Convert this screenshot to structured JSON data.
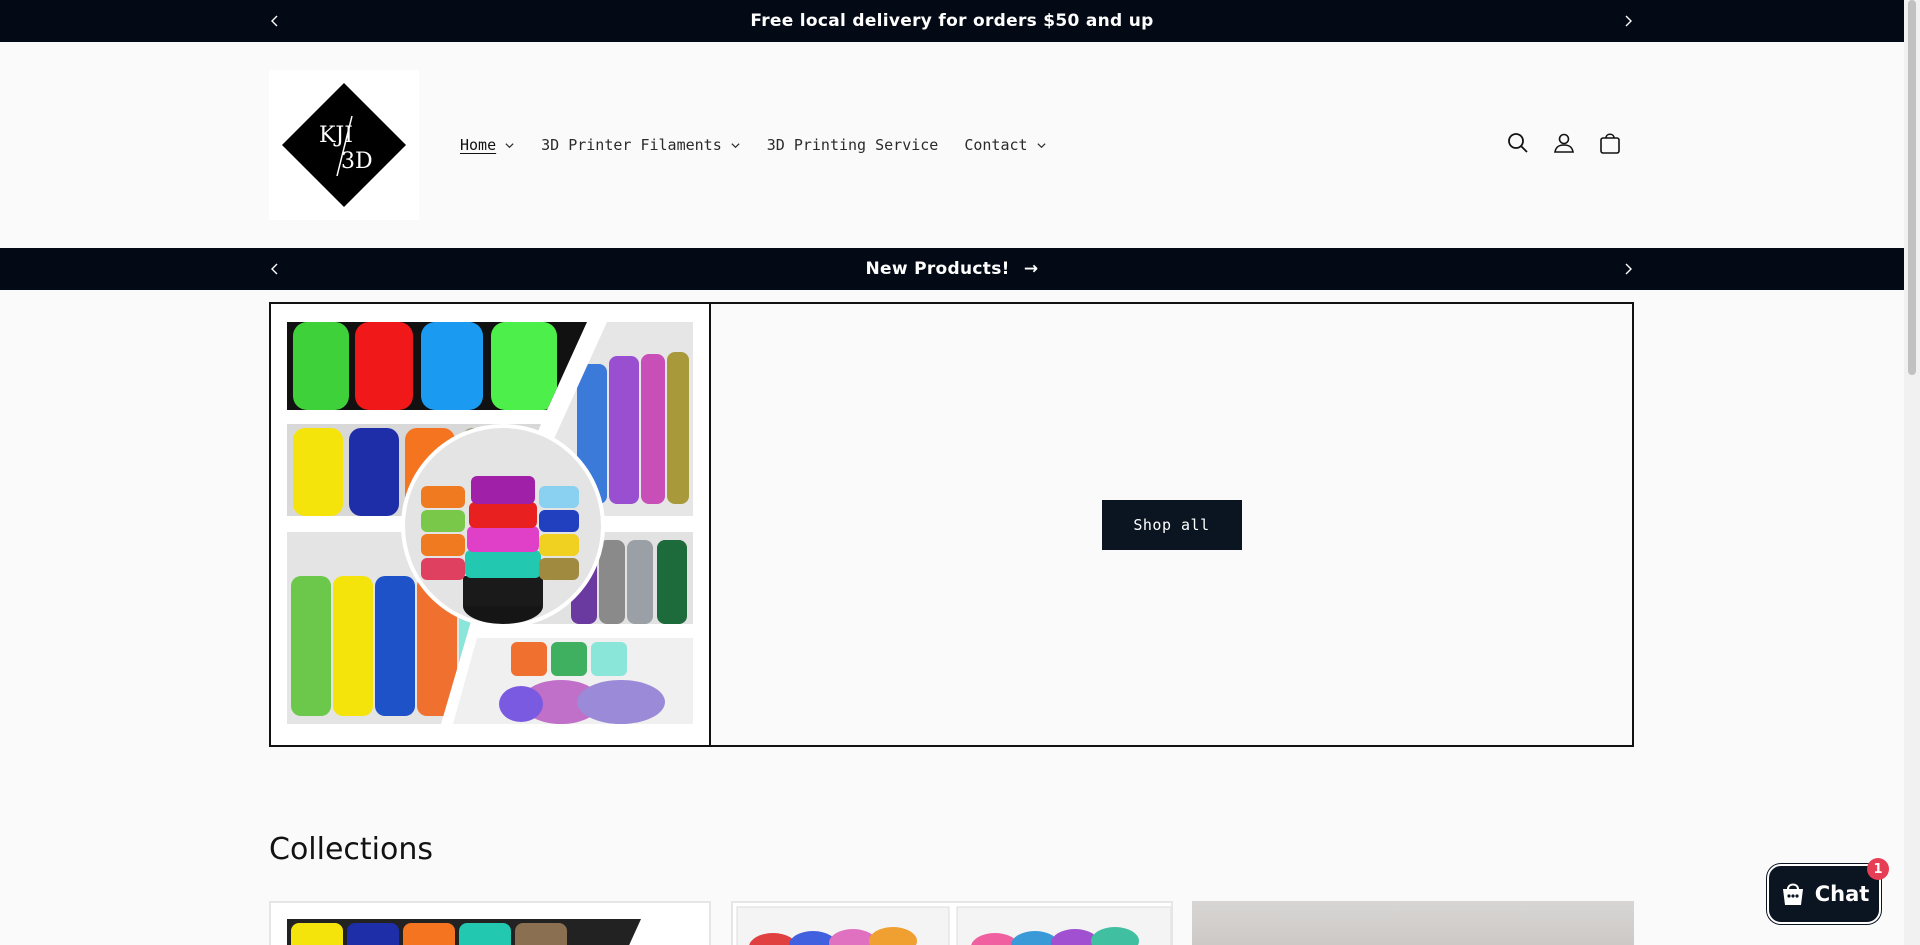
{
  "announcement_top": {
    "text": "Free local delivery for orders $50 and up"
  },
  "announcement_mid": {
    "text": "New Products!",
    "arrow": "→"
  },
  "logo": {
    "text_top": "KJI",
    "text_bottom": "3D"
  },
  "nav": {
    "items": [
      {
        "label": "Home",
        "has_dropdown": true,
        "active": true
      },
      {
        "label": "3D Printer Filaments",
        "has_dropdown": true
      },
      {
        "label": "3D Printing Service",
        "has_dropdown": false
      },
      {
        "label": "Contact",
        "has_dropdown": true
      }
    ]
  },
  "header_icons": [
    "search-icon",
    "account-icon",
    "cart-icon"
  ],
  "hero": {
    "button_label": "Shop all"
  },
  "collections": {
    "title": "Collections"
  },
  "chat": {
    "label": "Chat",
    "badge": "1"
  },
  "colors": {
    "dark": "#040a15",
    "button": "#0b1421",
    "badge": "#e53e55",
    "background": "#fafafa"
  }
}
